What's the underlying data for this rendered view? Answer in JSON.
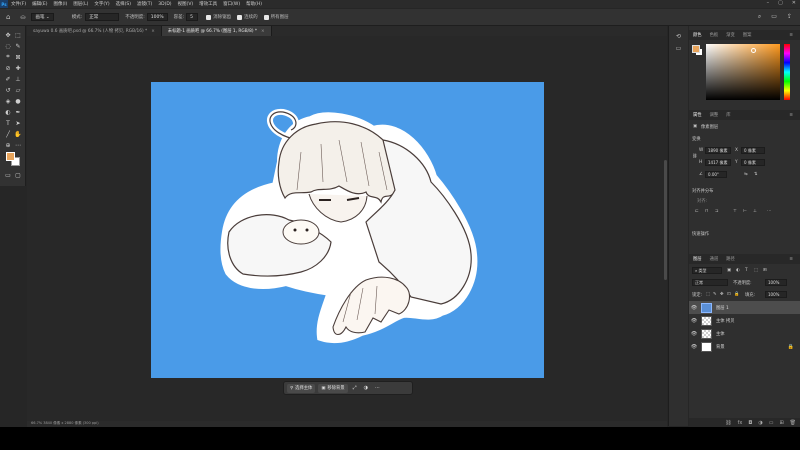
{
  "menubar": {
    "logo": "Ps",
    "items": [
      "文件(F)",
      "编辑(E)",
      "图像(I)",
      "图层(L)",
      "文字(Y)",
      "选择(S)",
      "滤镜(T)",
      "3D(D)",
      "视图(V)",
      "增效工具",
      "窗口(W)",
      "帮助(H)"
    ]
  },
  "options": {
    "brush_label": "画笔",
    "mode_label": "模式:",
    "mode_value": "正常",
    "opacity_label": "不透明度:",
    "opacity_value": "100%",
    "tolerance_label": "容差:",
    "tolerance_value": "5",
    "antialias_label": "消除锯齿",
    "contiguous_label": "连续的",
    "all_layers_label": "所有图层"
  },
  "tabs": [
    {
      "label": "sayuwa 0.6 画质吧.psd @ 66.7% (人物 拷贝, RGB/16) *",
      "active": false
    },
    {
      "label": "未标题-1 画质吧 @ 66.7% (图层 1, RGB/8) *",
      "active": true
    }
  ],
  "context_bar": {
    "select_subject": "选择主体",
    "remove_bg": "移除背景"
  },
  "statusbar": "66.7%   3840 像素 x 2880 像素 (300 ppi)",
  "panels": {
    "color_tabs": [
      "颜色",
      "色板",
      "渐变",
      "图案"
    ],
    "props_tabs": [
      "属性",
      "调整",
      "库"
    ],
    "props_title": "像素图层",
    "transform_title": "变换",
    "w_label": "W",
    "w_value": "1890 像素",
    "x_label": "X",
    "x_value": "0 像素",
    "h_label": "H",
    "h_value": "1417 像素",
    "y_label": "Y",
    "y_value": "0 像素",
    "angle_value": "0.00°",
    "align_title": "对齐并分布",
    "align_sub": "对齐:",
    "quick_title": "快速操作",
    "layers_tabs": [
      "图层",
      "通道",
      "路径"
    ],
    "kind_label": "类型",
    "blend_mode": "正常",
    "opacity_label": "不透明度:",
    "opacity_value": "100%",
    "lock_label": "锁定:",
    "fill_label": "填充:",
    "fill_value": "100%",
    "layers": [
      {
        "name": "图层 1",
        "thumb": "active",
        "selected": true,
        "locked": false
      },
      {
        "name": "主体 拷贝",
        "thumb": "checker",
        "selected": false,
        "locked": false
      },
      {
        "name": "主体",
        "thumb": "checker",
        "selected": false,
        "locked": false
      },
      {
        "name": "背景",
        "thumb": "white",
        "selected": false,
        "locked": true
      }
    ]
  },
  "colors": {
    "foreground": "#e8a45b",
    "background": "#ffffff",
    "artboard": "#4a9be8"
  }
}
